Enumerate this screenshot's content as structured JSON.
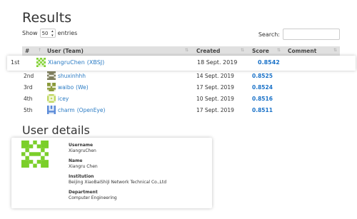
{
  "page": {
    "results_heading": "Results",
    "user_details_heading": "User details"
  },
  "controls": {
    "show_label": "Show",
    "entries_value": "50",
    "entries_label": "entries",
    "search_label": "Search:"
  },
  "table": {
    "headers": {
      "rank": "#",
      "user": "User (Team)",
      "created": "Created",
      "score": "Score",
      "comment": "Comment"
    },
    "rows": [
      {
        "rank": "1st",
        "user": "XiangruChen",
        "team": "(XBSJ)",
        "created": "18 Sept. 2019",
        "score": "0.8542",
        "avatar_color": "#7bcf2a"
      },
      {
        "rank": "2nd",
        "user": "shuxinhhh",
        "team": "",
        "created": "14 Sept. 2019",
        "score": "0.8525",
        "avatar_color": "#7a7a5a"
      },
      {
        "rank": "3rd",
        "user": "waibo",
        "team": "(We)",
        "created": "17 Sept. 2019",
        "score": "0.8524",
        "avatar_color": "#8a9a3a"
      },
      {
        "rank": "4th",
        "user": "icey",
        "team": "",
        "created": "10 Sept. 2019",
        "score": "0.8516",
        "avatar_color": "#c0d860"
      },
      {
        "rank": "5th",
        "user": "charm",
        "team": "(OpenEye)",
        "created": "17 Sept. 2019",
        "score": "0.8511",
        "avatar_color": "#5a8ad8"
      }
    ]
  },
  "details": {
    "username_label": "Username",
    "username": "XiangruChen",
    "name_label": "Name",
    "name": "Xiangru Chen",
    "institution_label": "Institution",
    "institution": "Beijing XiaoBaiShiJi Network Technical Co.,Ltd",
    "department_label": "Department",
    "department": "Computer Engineering"
  },
  "colors": {
    "score": "#1a72c8",
    "link": "#2a7bc4",
    "header_bg": "#e0e0e0",
    "card_avatar": "#7bcf2a"
  },
  "icons": [
    "sort-icon",
    "select-arrow-icon",
    "identicon-avatar"
  ]
}
